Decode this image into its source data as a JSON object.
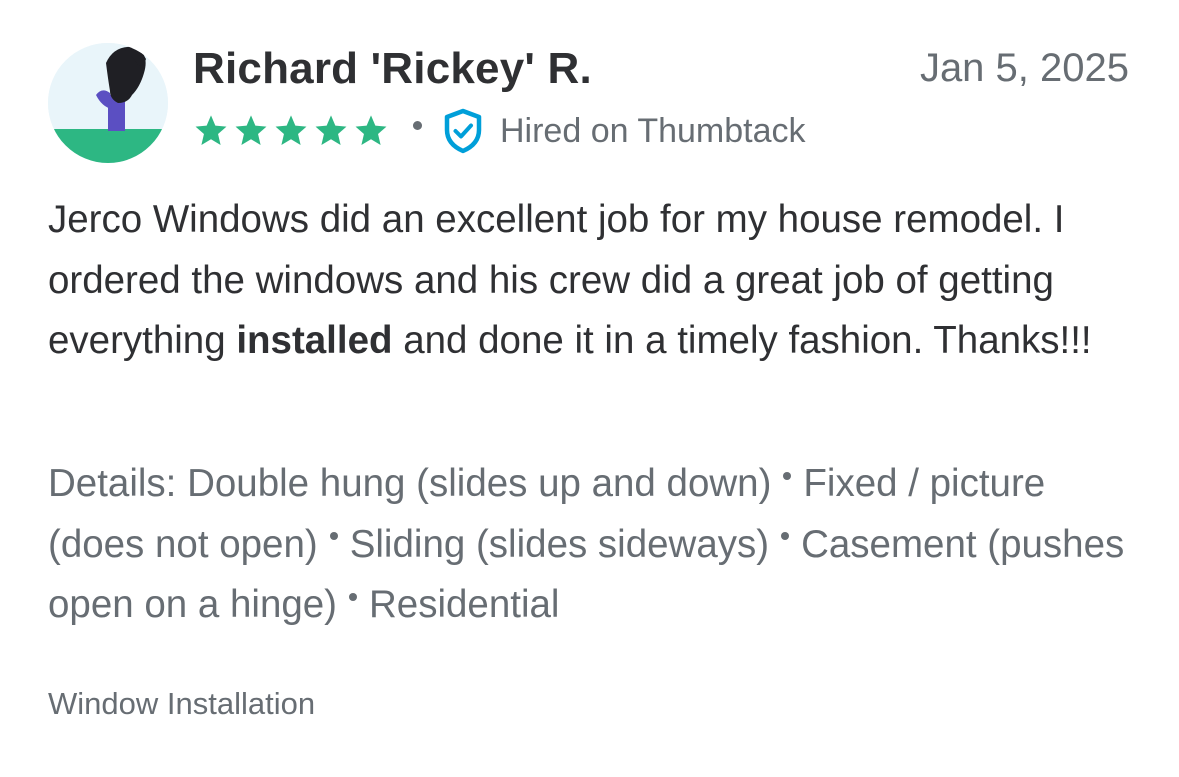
{
  "review": {
    "reviewer_name": "Richard 'Rickey' R.",
    "date": "Jan 5, 2025",
    "rating": 5,
    "rating_max": 5,
    "star_color": "#2db783",
    "badge_icon": "shield-check-icon",
    "badge_color": "#009fd9",
    "badge_text": "Hired on Thumbtack",
    "body": {
      "part1": "Jerco Windows did an excellent job for my house remodel. I ordered the windows and his crew did a great job of getting everything ",
      "highlight": "installed",
      "part2": " and done it in a timely fashion. Thanks!!!"
    },
    "details_label": "Details:",
    "details": [
      "Double hung (slides up and down)",
      "Fixed / picture (does not open)",
      "Sliding (slides sideways)",
      "Casement (pushes open on a hinge)",
      "Residential"
    ],
    "category": "Window Installation"
  }
}
